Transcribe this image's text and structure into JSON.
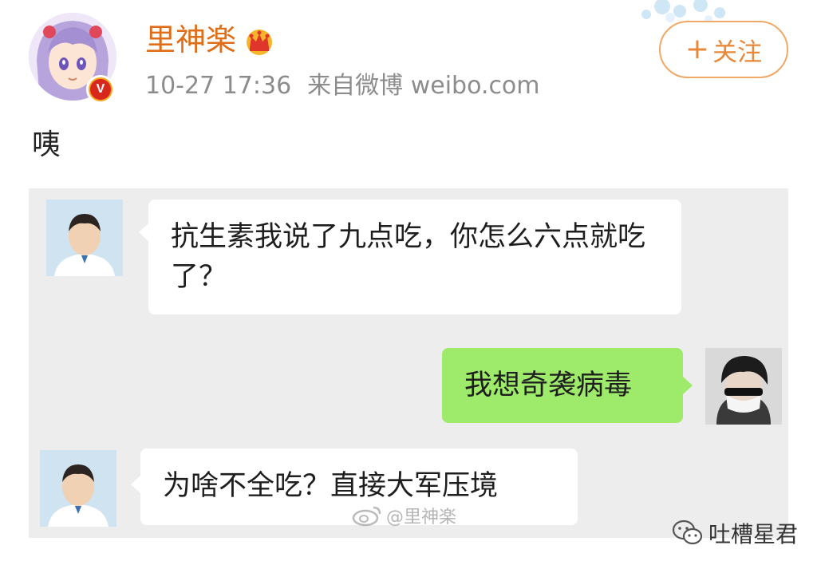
{
  "post": {
    "username": "里神楽",
    "timestamp": "10-27 17:36",
    "source": "来自微博 weibo.com",
    "follow_button": {
      "plus": "+",
      "label": "关注"
    },
    "text": "咦",
    "verified_badge": "V"
  },
  "chat": {
    "messages": [
      {
        "side": "left",
        "text": "抗生素我说了九点吃，你怎么六点就吃了？"
      },
      {
        "side": "right",
        "text": "我想奇袭病毒"
      },
      {
        "side": "left",
        "text": "为啥不全吃？直接大军压境"
      }
    ]
  },
  "watermark": {
    "text": "@里神楽"
  },
  "wechat_account": {
    "name": "吐槽星君"
  },
  "colors": {
    "username": "#e06d18",
    "follow_border": "#f0a866",
    "meta_text": "#8c8c8c",
    "chat_background": "#ededed",
    "bubble_sent": "#9eea6a",
    "bubble_received": "#ffffff"
  },
  "icons": [
    "crown-icon",
    "verified-badge-icon",
    "plus-icon",
    "weibo-watermark-icon",
    "wechat-icon"
  ]
}
